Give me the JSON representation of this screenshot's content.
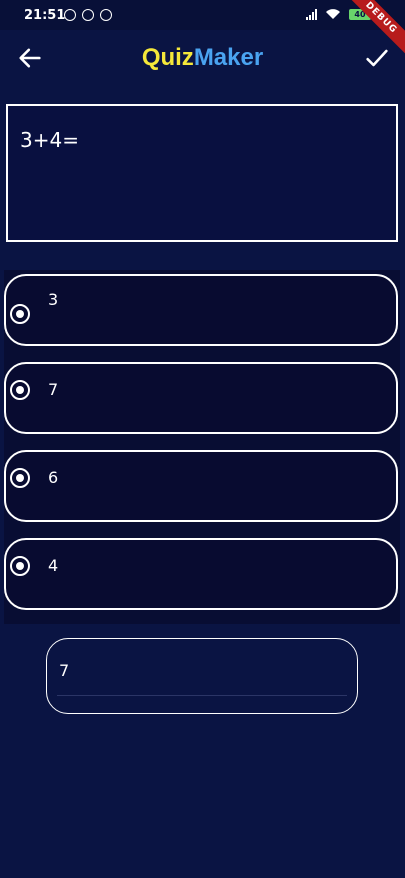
{
  "status_bar": {
    "time": "21:51",
    "battery": "40"
  },
  "debug_ribbon": "DEBUG",
  "app_bar": {
    "title_part1": "Quiz",
    "title_part2": "Maker",
    "title_part1_color": "#f5e83a",
    "title_part2_color": "#4aa3f0",
    "back_icon": "arrow-left-icon",
    "confirm_icon": "check-icon"
  },
  "question": {
    "text": "3+4="
  },
  "options": [
    {
      "label": "3"
    },
    {
      "label": "7"
    },
    {
      "label": "6"
    },
    {
      "label": "4"
    }
  ],
  "answer": {
    "value": "7"
  }
}
